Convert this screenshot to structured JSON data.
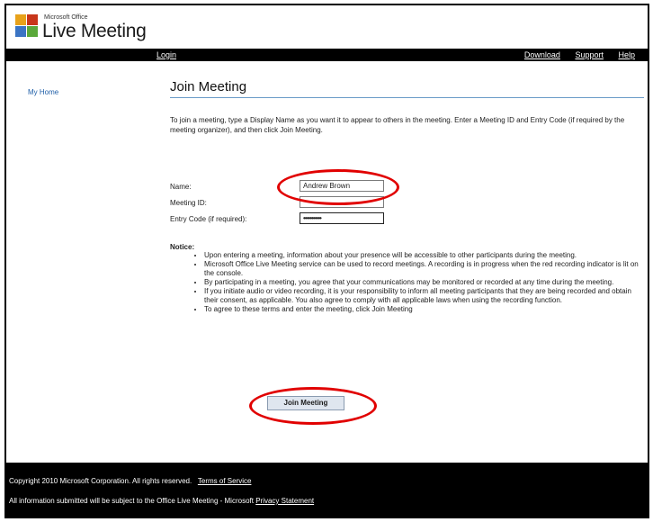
{
  "header": {
    "logo_small": "Microsoft Office",
    "logo_big": "Live Meeting",
    "logo_colors": [
      "#e8a21a",
      "#c8361a",
      "#3b74c4",
      "#5aa83a"
    ]
  },
  "topbar": {
    "login": "Login",
    "links": [
      "Download",
      "Support",
      "Help"
    ]
  },
  "sidebar": {
    "home": "My Home"
  },
  "main": {
    "title": "Join Meeting",
    "intro": "To join a meeting, type a Display Name as you want it to appear to others in the meeting. Enter a Meeting ID and Entry Code (if required by the meeting organizer), and then click Join Meeting.",
    "form": {
      "name_label": "Name:",
      "name_value": "Andrew Brown",
      "meeting_id_label": "Meeting ID:",
      "meeting_id_value": "",
      "entry_code_label": "Entry Code (if required):",
      "entry_code_value": "•••••••••••"
    },
    "notice": {
      "title": "Notice:",
      "items": [
        "Upon entering a meeting, information about your presence will be accessible to other participants during the meeting.",
        "Microsoft Office Live Meeting service can be used to record meetings. A recording is in progress when the red recording indicator is lit on the console.",
        "By participating in a meeting, you agree that your communications may be monitored or recorded at any time during the meeting.",
        "If you initiate audio or video recording, it is your responsibility to inform all meeting participants that they are being recorded and obtain their consent, as applicable. You also agree to comply with all applicable laws when using the recording function.",
        "To agree to these terms and enter the meeting, click Join Meeting"
      ]
    },
    "join_button": "Join Meeting"
  },
  "footer": {
    "line1_text": "Copyright 2010 Microsoft Corporation. All rights reserved.",
    "line1_link": "Terms of Service",
    "line2_text": "All information submitted will be subject to the Office Live Meeting - Microsoft",
    "line2_link": "Privacy Statement"
  },
  "colors": {
    "annotation": "#e10000",
    "link": "#1f5fa8",
    "title_rule": "#6a9bc8"
  }
}
